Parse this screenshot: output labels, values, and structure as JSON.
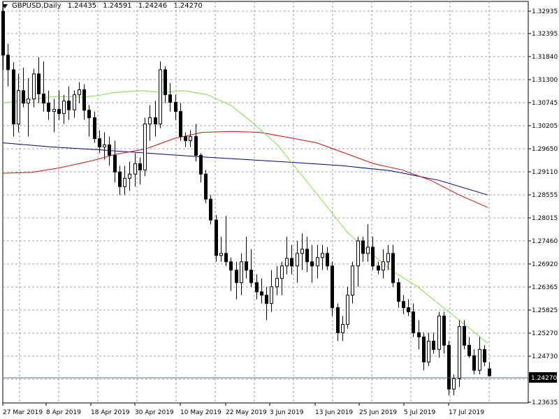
{
  "header": {
    "symbol_tf": "GBPUSD,Daily",
    "open": "1.24435",
    "high": "1.24591",
    "low": "1.24246",
    "close": "1.24270"
  },
  "current_price": "1.24270",
  "chart_data": {
    "type": "candlestick",
    "title": "GBPUSD,Daily",
    "ylim": [
      1.23635,
      1.3322
    ],
    "y_ticks": [
      "1.32935",
      "1.32395",
      "1.31840",
      "1.31300",
      "1.30745",
      "1.30205",
      "1.29650",
      "1.29110",
      "1.28555",
      "1.28015",
      "1.27460",
      "1.26920",
      "1.26365",
      "1.25825",
      "1.25270",
      "1.24730",
      "1.24270",
      "1.23635"
    ],
    "x_ticks": [
      "27 Mar 2019",
      "8 Apr 2019",
      "18 Apr 2019",
      "30 Apr 2019",
      "10 May 2019",
      "22 May 2019",
      "3 Jun 2019",
      "13 Jun 2019",
      "25 Jun 2019",
      "5 Jul 2019",
      "17 Jul 2019"
    ],
    "grid": true,
    "colors": {
      "bull_body": "#ffffff",
      "bear_body": "#000000",
      "wick": "#000000",
      "ma_fast": "#80e040",
      "ma_mid": "#d01010",
      "ma_slow": "#000080",
      "grid": "#9aa0a6"
    },
    "candles": [
      {
        "o": 1.33,
        "h": 1.3322,
        "l": 1.316,
        "c": 1.3195
      },
      {
        "o": 1.3195,
        "h": 1.3222,
        "l": 1.312,
        "c": 1.316
      },
      {
        "o": 1.316,
        "h": 1.3178,
        "l": 1.3,
        "c": 1.303
      },
      {
        "o": 1.303,
        "h": 1.315,
        "l": 1.301,
        "c": 1.311
      },
      {
        "o": 1.311,
        "h": 1.3165,
        "l": 1.307,
        "c": 1.308
      },
      {
        "o": 1.308,
        "h": 1.314,
        "l": 1.3,
        "c": 1.309
      },
      {
        "o": 1.309,
        "h": 1.3162,
        "l": 1.307,
        "c": 1.315
      },
      {
        "o": 1.315,
        "h": 1.319,
        "l": 1.308,
        "c": 1.3102
      },
      {
        "o": 1.3102,
        "h": 1.318,
        "l": 1.306,
        "c": 1.308
      },
      {
        "o": 1.308,
        "h": 1.311,
        "l": 1.304,
        "c": 1.306
      },
      {
        "o": 1.306,
        "h": 1.309,
        "l": 1.301,
        "c": 1.3065
      },
      {
        "o": 1.3065,
        "h": 1.311,
        "l": 1.304,
        "c": 1.3055
      },
      {
        "o": 1.3055,
        "h": 1.31,
        "l": 1.303,
        "c": 1.3085
      },
      {
        "o": 1.3085,
        "h": 1.312,
        "l": 1.304,
        "c": 1.3064
      },
      {
        "o": 1.3064,
        "h": 1.311,
        "l": 1.3045,
        "c": 1.31
      },
      {
        "o": 1.31,
        "h": 1.313,
        "l": 1.308,
        "c": 1.3112
      },
      {
        "o": 1.3112,
        "h": 1.3125,
        "l": 1.304,
        "c": 1.3063
      },
      {
        "o": 1.3063,
        "h": 1.3075,
        "l": 1.3,
        "c": 1.3045
      },
      {
        "o": 1.3045,
        "h": 1.306,
        "l": 1.2985,
        "c": 1.2995
      },
      {
        "o": 1.2995,
        "h": 1.3015,
        "l": 1.296,
        "c": 1.2975
      },
      {
        "o": 1.2975,
        "h": 1.301,
        "l": 1.2945,
        "c": 1.298
      },
      {
        "o": 1.298,
        "h": 1.3,
        "l": 1.293,
        "c": 1.2955
      },
      {
        "o": 1.2955,
        "h": 1.299,
        "l": 1.289,
        "c": 1.2915
      },
      {
        "o": 1.2915,
        "h": 1.293,
        "l": 1.286,
        "c": 1.288
      },
      {
        "o": 1.288,
        "h": 1.293,
        "l": 1.286,
        "c": 1.29
      },
      {
        "o": 1.29,
        "h": 1.294,
        "l": 1.287,
        "c": 1.291
      },
      {
        "o": 1.291,
        "h": 1.296,
        "l": 1.288,
        "c": 1.2935
      },
      {
        "o": 1.2935,
        "h": 1.295,
        "l": 1.2885,
        "c": 1.292
      },
      {
        "o": 1.292,
        "h": 1.3045,
        "l": 1.2905,
        "c": 1.303
      },
      {
        "o": 1.303,
        "h": 1.3075,
        "l": 1.299,
        "c": 1.3045
      },
      {
        "o": 1.3045,
        "h": 1.3085,
        "l": 1.3,
        "c": 1.303
      },
      {
        "o": 1.303,
        "h": 1.318,
        "l": 1.302,
        "c": 1.316
      },
      {
        "o": 1.316,
        "h": 1.3168,
        "l": 1.308,
        "c": 1.31
      },
      {
        "o": 1.31,
        "h": 1.3128,
        "l": 1.306,
        "c": 1.3082
      },
      {
        "o": 1.3082,
        "h": 1.31,
        "l": 1.304,
        "c": 1.306
      },
      {
        "o": 1.306,
        "h": 1.308,
        "l": 1.299,
        "c": 1.3
      },
      {
        "o": 1.3,
        "h": 1.301,
        "l": 1.2975,
        "c": 1.299
      },
      {
        "o": 1.299,
        "h": 1.3015,
        "l": 1.2975,
        "c": 1.3
      },
      {
        "o": 1.3,
        "h": 1.303,
        "l": 1.294,
        "c": 1.2955
      },
      {
        "o": 1.2955,
        "h": 1.296,
        "l": 1.289,
        "c": 1.291
      },
      {
        "o": 1.291,
        "h": 1.292,
        "l": 1.284,
        "c": 1.285
      },
      {
        "o": 1.285,
        "h": 1.286,
        "l": 1.279,
        "c": 1.28
      },
      {
        "o": 1.28,
        "h": 1.2812,
        "l": 1.27,
        "c": 1.2715
      },
      {
        "o": 1.2715,
        "h": 1.276,
        "l": 1.27,
        "c": 1.272
      },
      {
        "o": 1.272,
        "h": 1.281,
        "l": 1.269,
        "c": 1.27
      },
      {
        "o": 1.27,
        "h": 1.271,
        "l": 1.263,
        "c": 1.268
      },
      {
        "o": 1.268,
        "h": 1.27,
        "l": 1.261,
        "c": 1.265
      },
      {
        "o": 1.265,
        "h": 1.272,
        "l": 1.262,
        "c": 1.27
      },
      {
        "o": 1.27,
        "h": 1.276,
        "l": 1.266,
        "c": 1.268
      },
      {
        "o": 1.268,
        "h": 1.273,
        "l": 1.264,
        "c": 1.265
      },
      {
        "o": 1.265,
        "h": 1.267,
        "l": 1.261,
        "c": 1.2628
      },
      {
        "o": 1.2628,
        "h": 1.266,
        "l": 1.26,
        "c": 1.262
      },
      {
        "o": 1.262,
        "h": 1.264,
        "l": 1.256,
        "c": 1.26
      },
      {
        "o": 1.26,
        "h": 1.268,
        "l": 1.258,
        "c": 1.264
      },
      {
        "o": 1.264,
        "h": 1.269,
        "l": 1.262,
        "c": 1.266
      },
      {
        "o": 1.266,
        "h": 1.27,
        "l": 1.262,
        "c": 1.269
      },
      {
        "o": 1.269,
        "h": 1.276,
        "l": 1.267,
        "c": 1.2708
      },
      {
        "o": 1.2708,
        "h": 1.274,
        "l": 1.267,
        "c": 1.269
      },
      {
        "o": 1.269,
        "h": 1.275,
        "l": 1.265,
        "c": 1.272
      },
      {
        "o": 1.272,
        "h": 1.2768,
        "l": 1.268,
        "c": 1.273
      },
      {
        "o": 1.273,
        "h": 1.276,
        "l": 1.2675,
        "c": 1.27
      },
      {
        "o": 1.27,
        "h": 1.274,
        "l": 1.265,
        "c": 1.269
      },
      {
        "o": 1.269,
        "h": 1.274,
        "l": 1.266,
        "c": 1.271
      },
      {
        "o": 1.271,
        "h": 1.274,
        "l": 1.268,
        "c": 1.272
      },
      {
        "o": 1.272,
        "h": 1.2735,
        "l": 1.268,
        "c": 1.269
      },
      {
        "o": 1.269,
        "h": 1.27,
        "l": 1.257,
        "c": 1.259
      },
      {
        "o": 1.259,
        "h": 1.26,
        "l": 1.251,
        "c": 1.253
      },
      {
        "o": 1.253,
        "h": 1.257,
        "l": 1.251,
        "c": 1.255
      },
      {
        "o": 1.255,
        "h": 1.264,
        "l": 1.254,
        "c": 1.262
      },
      {
        "o": 1.262,
        "h": 1.27,
        "l": 1.26,
        "c": 1.269
      },
      {
        "o": 1.269,
        "h": 1.276,
        "l": 1.264,
        "c": 1.275
      },
      {
        "o": 1.275,
        "h": 1.276,
        "l": 1.27,
        "c": 1.272
      },
      {
        "o": 1.272,
        "h": 1.279,
        "l": 1.27,
        "c": 1.2735
      },
      {
        "o": 1.2735,
        "h": 1.276,
        "l": 1.268,
        "c": 1.269
      },
      {
        "o": 1.269,
        "h": 1.27,
        "l": 1.267,
        "c": 1.268
      },
      {
        "o": 1.268,
        "h": 1.273,
        "l": 1.266,
        "c": 1.27
      },
      {
        "o": 1.27,
        "h": 1.274,
        "l": 1.268,
        "c": 1.272
      },
      {
        "o": 1.272,
        "h": 1.274,
        "l": 1.264,
        "c": 1.265
      },
      {
        "o": 1.265,
        "h": 1.266,
        "l": 1.259,
        "c": 1.2605
      },
      {
        "o": 1.2605,
        "h": 1.262,
        "l": 1.2575,
        "c": 1.259
      },
      {
        "o": 1.259,
        "h": 1.261,
        "l": 1.257,
        "c": 1.258
      },
      {
        "o": 1.258,
        "h": 1.26,
        "l": 1.252,
        "c": 1.253
      },
      {
        "o": 1.253,
        "h": 1.256,
        "l": 1.249,
        "c": 1.252
      },
      {
        "o": 1.252,
        "h": 1.253,
        "l": 1.244,
        "c": 1.246
      },
      {
        "o": 1.246,
        "h": 1.253,
        "l": 1.245,
        "c": 1.251
      },
      {
        "o": 1.251,
        "h": 1.253,
        "l": 1.248,
        "c": 1.249
      },
      {
        "o": 1.249,
        "h": 1.258,
        "l": 1.247,
        "c": 1.257
      },
      {
        "o": 1.257,
        "h": 1.258,
        "l": 1.248,
        "c": 1.25
      },
      {
        "o": 1.25,
        "h": 1.251,
        "l": 1.238,
        "c": 1.2395
      },
      {
        "o": 1.2395,
        "h": 1.243,
        "l": 1.238,
        "c": 1.242
      },
      {
        "o": 1.242,
        "h": 1.256,
        "l": 1.24,
        "c": 1.2545
      },
      {
        "o": 1.2545,
        "h": 1.256,
        "l": 1.249,
        "c": 1.25
      },
      {
        "o": 1.25,
        "h": 1.252,
        "l": 1.247,
        "c": 1.2475
      },
      {
        "o": 1.2475,
        "h": 1.249,
        "l": 1.243,
        "c": 1.244
      },
      {
        "o": 1.244,
        "h": 1.252,
        "l": 1.243,
        "c": 1.249
      },
      {
        "o": 1.249,
        "h": 1.25,
        "l": 1.245,
        "c": 1.246
      },
      {
        "o": 1.24435,
        "h": 1.24591,
        "l": 1.24246,
        "c": 1.2427
      }
    ],
    "ma_fast": [
      [
        1.308,
        1.3086,
        1.309,
        1.3095,
        1.3096,
        1.3094,
        1.3098,
        1.3105,
        1.3108,
        1.311,
        1.3105
      ],
      [
        1.3105,
        1.311,
        1.31,
        1.3075,
        1.303,
        1.298,
        1.291,
        1.284,
        1.277,
        1.272,
        1.2675,
        1.264,
        1.2595,
        1.255,
        1.2505
      ]
    ],
    "ma_mid": [
      1.2912,
      1.2914,
      1.2925,
      1.294,
      1.2958,
      1.297,
      1.2995,
      1.301,
      1.3012,
      1.301,
      1.2998,
      1.2985,
      1.296,
      1.2935,
      1.292,
      1.2895,
      1.286,
      1.283
    ],
    "ma_slow": [
      1.2985,
      1.2975,
      1.2968,
      1.296,
      1.2952,
      1.2945,
      1.2938,
      1.293,
      1.2918,
      1.2895,
      1.286
    ]
  }
}
